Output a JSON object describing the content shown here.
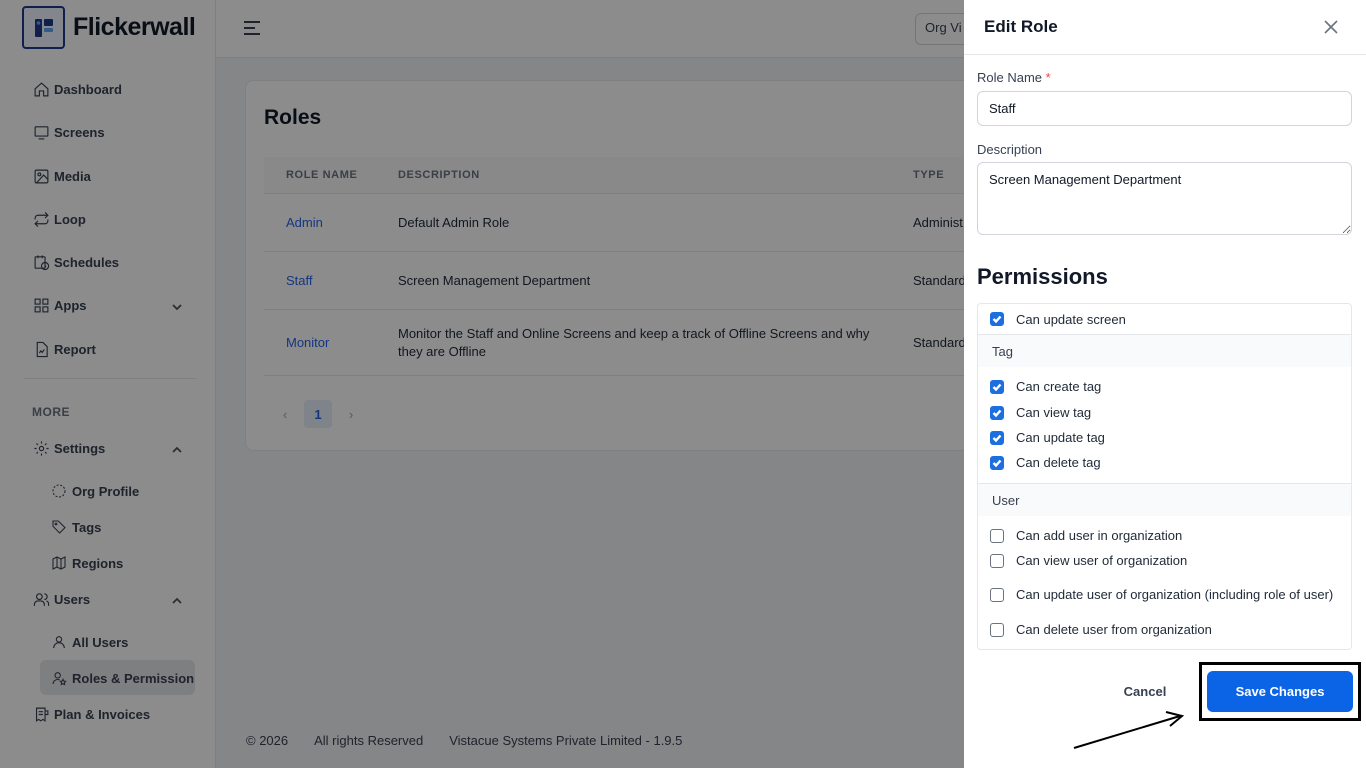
{
  "app": {
    "name": "Flickerwall"
  },
  "sidebar": {
    "items": [
      {
        "label": "Dashboard",
        "icon": "home-icon"
      },
      {
        "label": "Screens",
        "icon": "monitor-icon"
      },
      {
        "label": "Media",
        "icon": "image-icon"
      },
      {
        "label": "Loop",
        "icon": "repeat-icon"
      },
      {
        "label": "Schedules",
        "icon": "calendar-clock-icon"
      },
      {
        "label": "Apps",
        "icon": "grid-icon"
      },
      {
        "label": "Report",
        "icon": "file-chart-icon"
      }
    ],
    "more_label": "MORE",
    "settings": {
      "label": "Settings",
      "children": [
        "Org Profile",
        "Tags",
        "Regions"
      ]
    },
    "users": {
      "label": "Users",
      "children": [
        "All Users",
        "Roles & Permission"
      ]
    },
    "plan": {
      "label": "Plan & Invoices"
    }
  },
  "topbar": {
    "org_view_label": "Org Vi"
  },
  "roles_page": {
    "title": "Roles",
    "columns": [
      "ROLE NAME",
      "DESCRIPTION",
      "TYPE"
    ],
    "rows": [
      {
        "name": "Admin",
        "description": "Default Admin Role",
        "type": "Administ"
      },
      {
        "name": "Staff",
        "description": "Screen Management Department",
        "type": "Standard"
      },
      {
        "name": "Monitor",
        "description": "Monitor the Staff and Online Screens and keep a track of Offline Screens and why they are Offline",
        "type": "Standard"
      }
    ],
    "pagination": {
      "prev": "‹",
      "page": "1",
      "next": "›"
    }
  },
  "footer": {
    "copyright": "© 2026",
    "rights": "All rights Reserved",
    "company": "Vistacue Systems Private Limited - 1.9.5"
  },
  "edit_role": {
    "title": "Edit Role",
    "role_name_label": "Role Name",
    "required_mark": "*",
    "role_name_value": "Staff",
    "description_label": "Description",
    "description_value": "Screen Management Department",
    "permissions_title": "Permissions",
    "screen_perms": [
      {
        "label": "Can update screen",
        "checked": true
      }
    ],
    "tag_group": "Tag",
    "tag_perms": [
      {
        "label": "Can create tag",
        "checked": true
      },
      {
        "label": "Can view tag",
        "checked": true
      },
      {
        "label": "Can update tag",
        "checked": true
      },
      {
        "label": "Can delete tag",
        "checked": true
      }
    ],
    "user_group": "User",
    "user_perms": [
      {
        "label": "Can add user in organization",
        "checked": false
      },
      {
        "label": "Can view user of organization",
        "checked": false
      },
      {
        "label": "Can update user of organization (including role of user)",
        "checked": false
      },
      {
        "label": "Can delete user from organization",
        "checked": false
      }
    ],
    "cancel_label": "Cancel",
    "save_label": "Save Changes"
  },
  "colors": {
    "primary": "#0b63e6",
    "link": "#2563eb",
    "checkbox_on": "#1d6fe0",
    "required": "#ef4444"
  }
}
